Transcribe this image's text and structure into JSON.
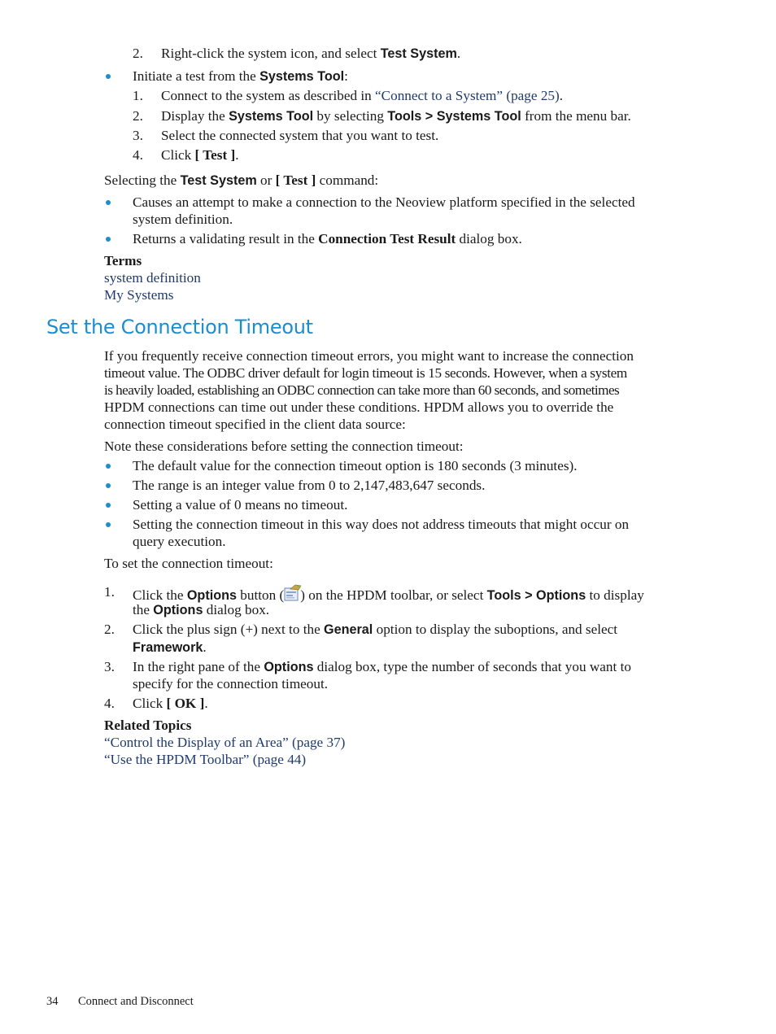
{
  "top_section": {
    "step2": {
      "num": "2.",
      "pre": "Right-click the system icon, and select ",
      "bold": "Test System",
      "post": "."
    },
    "bullet_systems_tool": {
      "pre": "Initiate a test from the ",
      "bold": "Systems Tool",
      "post": ":"
    },
    "steps": [
      {
        "num": "1.",
        "pre": "Connect to the system as described in ",
        "link": "“Connect to a System” (page 25)",
        "post": "."
      },
      {
        "num": "2.",
        "pre": "Display the ",
        "b1": "Systems Tool",
        "mid": " by selecting ",
        "b2": "Tools > Systems Tool",
        "post": " from the menu bar."
      },
      {
        "num": "3.",
        "text": "Select the connected system that you want to test."
      },
      {
        "num": "4.",
        "pre": "Click ",
        "bold": "[ Test ]",
        "post": "."
      }
    ],
    "selecting": {
      "pre": "Selecting the ",
      "b1": "Test System",
      "mid": " or ",
      "b2": "[ Test ]",
      "post": " command:"
    },
    "results": [
      {
        "line1": "Causes an attempt to make a connection to the Neoview platform specified in the selected",
        "line2": "system definition."
      },
      {
        "pre": "Returns a validating result in the ",
        "bold": "Connection Test Result",
        "post": " dialog box."
      }
    ],
    "terms_label": "Terms",
    "terms": [
      "system definition",
      "My Systems"
    ]
  },
  "section": {
    "title": "Set the Connection Timeout",
    "intro_lines": [
      "If you frequently receive connection timeout errors, you might want to increase the connection",
      "timeout value. The ODBC driver default for login timeout is 15 seconds. However, when a system",
      "is heavily loaded, establishing an ODBC connection can take more than 60 seconds, and sometimes",
      "HPDM connections can time out under these conditions. HPDM allows you to override the",
      "connection timeout specified in the client data source:"
    ],
    "note_intro": "Note these considerations before setting the connection timeout:",
    "considerations": [
      {
        "line1": "The default value for the connection timeout option is 180 seconds (3 minutes)."
      },
      {
        "line1": "The range is an integer value from 0 to 2,147,483,647 seconds."
      },
      {
        "line1": "Setting a value of 0 means no timeout."
      },
      {
        "line1": "Setting the connection timeout in this way does not address timeouts that might occur on",
        "line2": "query execution."
      }
    ],
    "procedure_intro": "To set the connection timeout:",
    "procedure": [
      {
        "num": "1.",
        "pre": "Click the ",
        "b1": "Options",
        "mid1": " button (",
        "mid2": ") on the HPDM toolbar, or select ",
        "b2": "Tools > Options",
        "post": " to display",
        "line2_pre": "the ",
        "line2_bold": "Options",
        "line2_post": " dialog box."
      },
      {
        "num": "2.",
        "pre": "Click the plus sign (+) next to the ",
        "bold": "General",
        "post": " option to display the suboptions, and select",
        "line2_bold": "Framework",
        "line2_post": "."
      },
      {
        "num": "3.",
        "pre": "In the right pane of the ",
        "bold": "Options",
        "post": " dialog box, type the number of seconds that you want to",
        "line2": "specify for the connection timeout."
      },
      {
        "num": "4.",
        "pre": "Click ",
        "bold": "[ OK ]",
        "post": "."
      }
    ],
    "related_label": "Related Topics",
    "related": [
      "“Control the Display of an Area” (page 37)",
      "“Use the HPDM Toolbar” (page 44)"
    ]
  },
  "footer": {
    "page_number": "34",
    "chapter": "Connect and Disconnect"
  },
  "colors": {
    "heading": "#1a8fcf",
    "link": "#1f3a6e",
    "bullet": "#1a8fd0"
  }
}
